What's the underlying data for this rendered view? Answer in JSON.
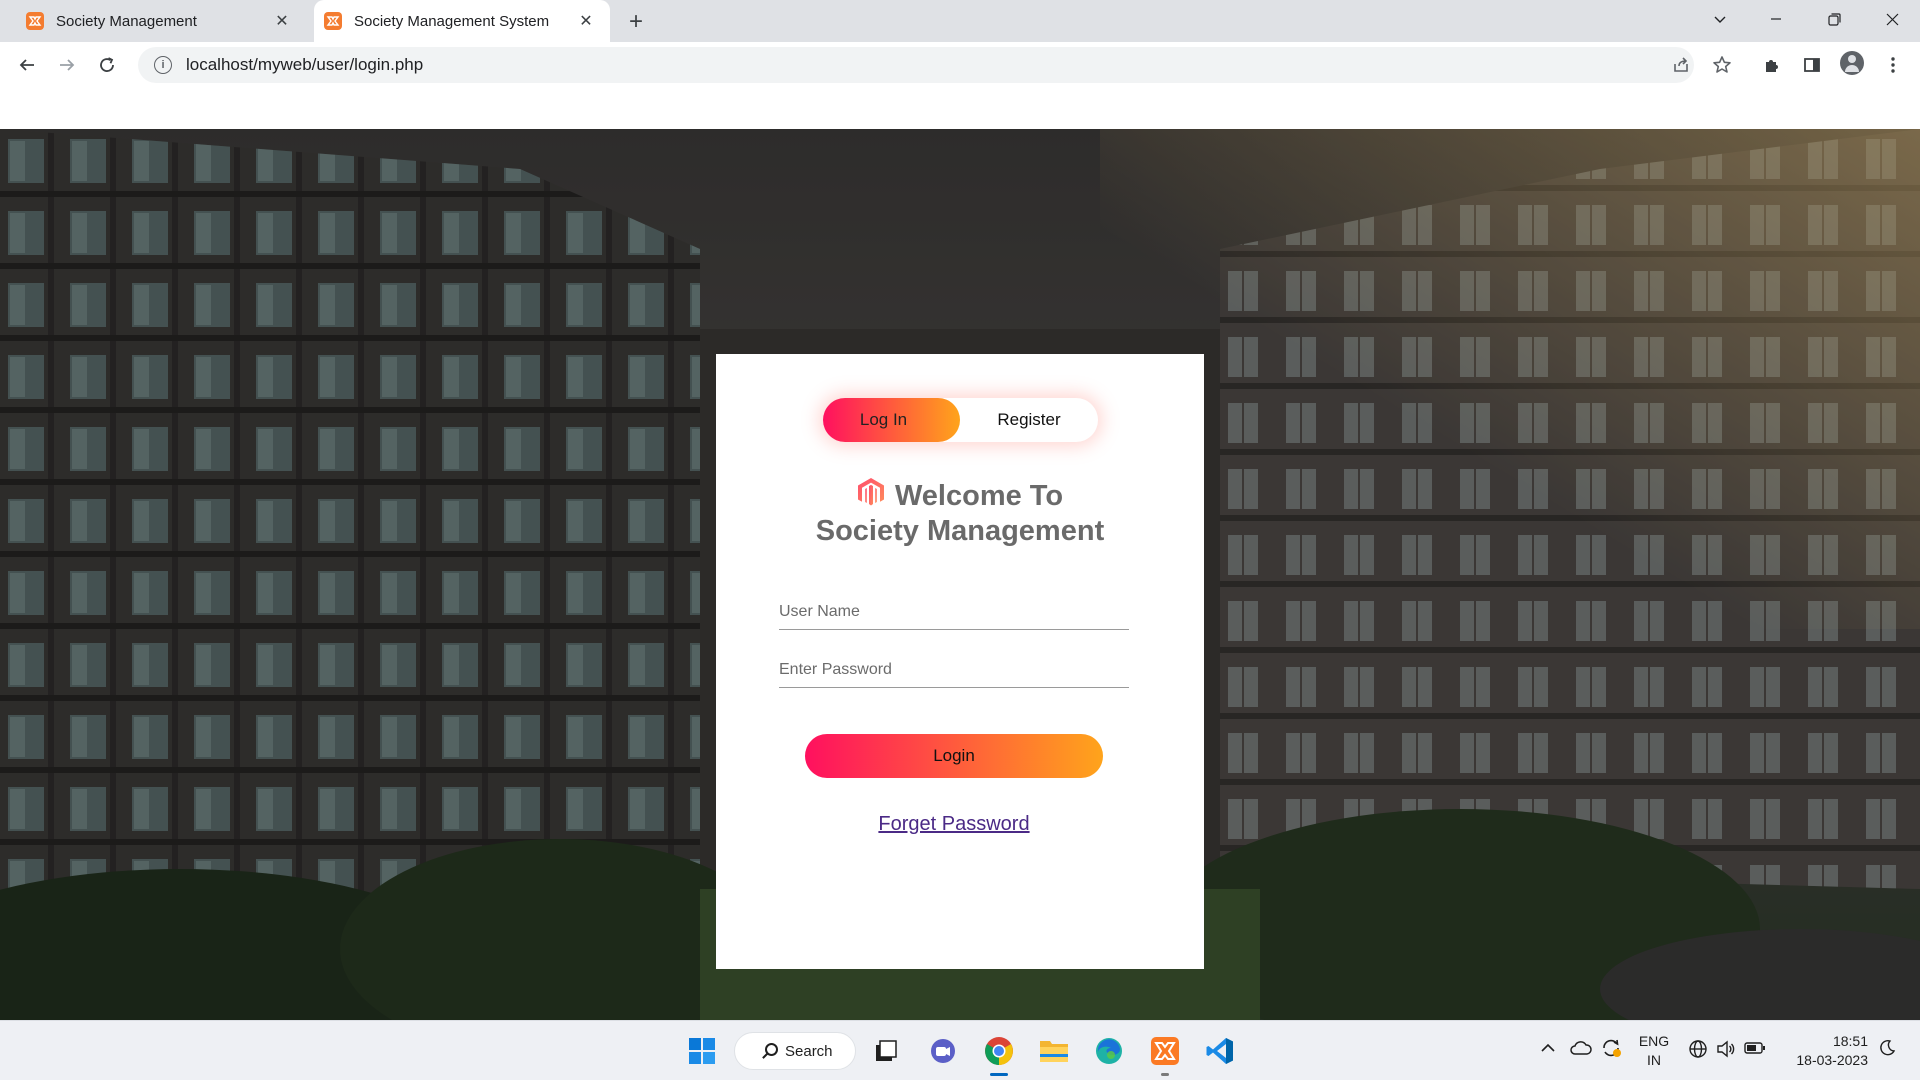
{
  "browser": {
    "tabs": [
      {
        "title": "Society Management",
        "favicon": "xampp-icon",
        "active": false
      },
      {
        "title": "Society Management System",
        "favicon": "xampp-icon",
        "active": true
      }
    ],
    "new_tab_symbol": "+",
    "url": "localhost/myweb/user/login.php",
    "close_symbol": "✕"
  },
  "login_card": {
    "toggle": {
      "login_label": "Log In",
      "register_label": "Register"
    },
    "heading_line1": "Welcome To",
    "heading_line2": "Society Management",
    "username_placeholder": "User Name",
    "password_placeholder": "Enter Password",
    "login_button": "Login",
    "forgot_link": "Forget Password",
    "accent_gradient": [
      "#ff105f",
      "#ffa41b"
    ]
  },
  "taskbar": {
    "search_label": "Search",
    "language": {
      "line1": "ENG",
      "line2": "IN"
    },
    "time": "18:51",
    "date": "18-03-2023",
    "pinned_apps": [
      "start-icon",
      "search",
      "task-view-icon",
      "chat-icon",
      "chrome-icon",
      "file-explorer-icon",
      "edge-icon",
      "xampp-icon",
      "vscode-icon"
    ]
  }
}
